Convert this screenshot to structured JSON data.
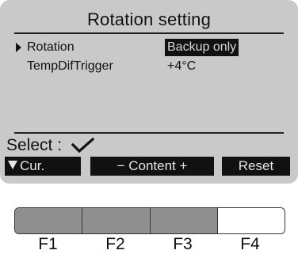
{
  "screen": {
    "title": "Rotation setting",
    "rows": [
      {
        "label": "Rotation",
        "value": "Backup only",
        "selected": true
      },
      {
        "label": "TempDifTrigger",
        "value": "+4°C",
        "selected": false
      }
    ],
    "select_label": "Select :",
    "softkeys": {
      "cursor_label": "Cur.",
      "content_label": "− Content +",
      "reset_label": "Reset"
    }
  },
  "function_buttons": [
    {
      "label": "F1"
    },
    {
      "label": "F2"
    },
    {
      "label": "F3"
    },
    {
      "label": "F4"
    }
  ],
  "colors": {
    "lcd_background": "#c9c9c9",
    "ink": "#111111",
    "button_gray": "#8f8f8f"
  }
}
